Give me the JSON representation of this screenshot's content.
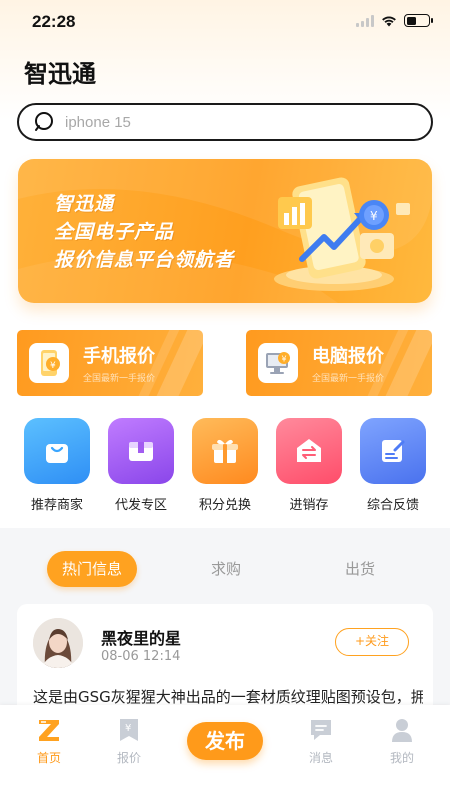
{
  "status_bar": {
    "time": "22:28"
  },
  "header": {
    "app_title": "智迅通"
  },
  "search": {
    "placeholder": "iphone 15"
  },
  "banner": {
    "line1": "智迅通",
    "line2": "全国电子产品",
    "line3": "报价信息平台领航者"
  },
  "price_cards": [
    {
      "title": "手机报价",
      "subtitle": "全国最新一手报价",
      "icon": "phone-price-icon"
    },
    {
      "title": "电脑报价",
      "subtitle": "全国最新一手报价",
      "icon": "computer-price-icon"
    }
  ],
  "quick_actions": [
    {
      "label": "推荐商家",
      "icon": "shopping-bag-icon",
      "color": "#3aa6ff"
    },
    {
      "label": "代发专区",
      "icon": "package-icon",
      "color": "#a25cf0"
    },
    {
      "label": "积分兑换",
      "icon": "gift-icon",
      "color": "#ff9a2e"
    },
    {
      "label": "进销存",
      "icon": "exchange-icon",
      "color": "#ff5e77"
    },
    {
      "label": "综合反馈",
      "icon": "edit-note-icon",
      "color": "#4f7cf6"
    }
  ],
  "tabs": [
    {
      "label": "热门信息",
      "active": true
    },
    {
      "label": "求购",
      "active": false
    },
    {
      "label": "出货",
      "active": false
    }
  ],
  "post": {
    "author": "黑夜里的星",
    "time": "08-06  12:14",
    "follow_label": "+关注",
    "body": "这是由GSG灰猩猩大神出品的一套材质纹理贴图预设包，拥"
  },
  "bottom_nav": {
    "items": [
      {
        "label": "首页",
        "icon": "home-z-icon",
        "active": true
      },
      {
        "label": "报价",
        "icon": "price-tag-icon",
        "active": false
      },
      {
        "label": "消息",
        "icon": "message-icon",
        "active": false
      },
      {
        "label": "我的",
        "icon": "user-icon",
        "active": false
      }
    ],
    "publish_label": "发布"
  },
  "colors": {
    "accent": "#ff9a1a",
    "accent_light": "#ffb13a",
    "text_muted": "#999999"
  }
}
